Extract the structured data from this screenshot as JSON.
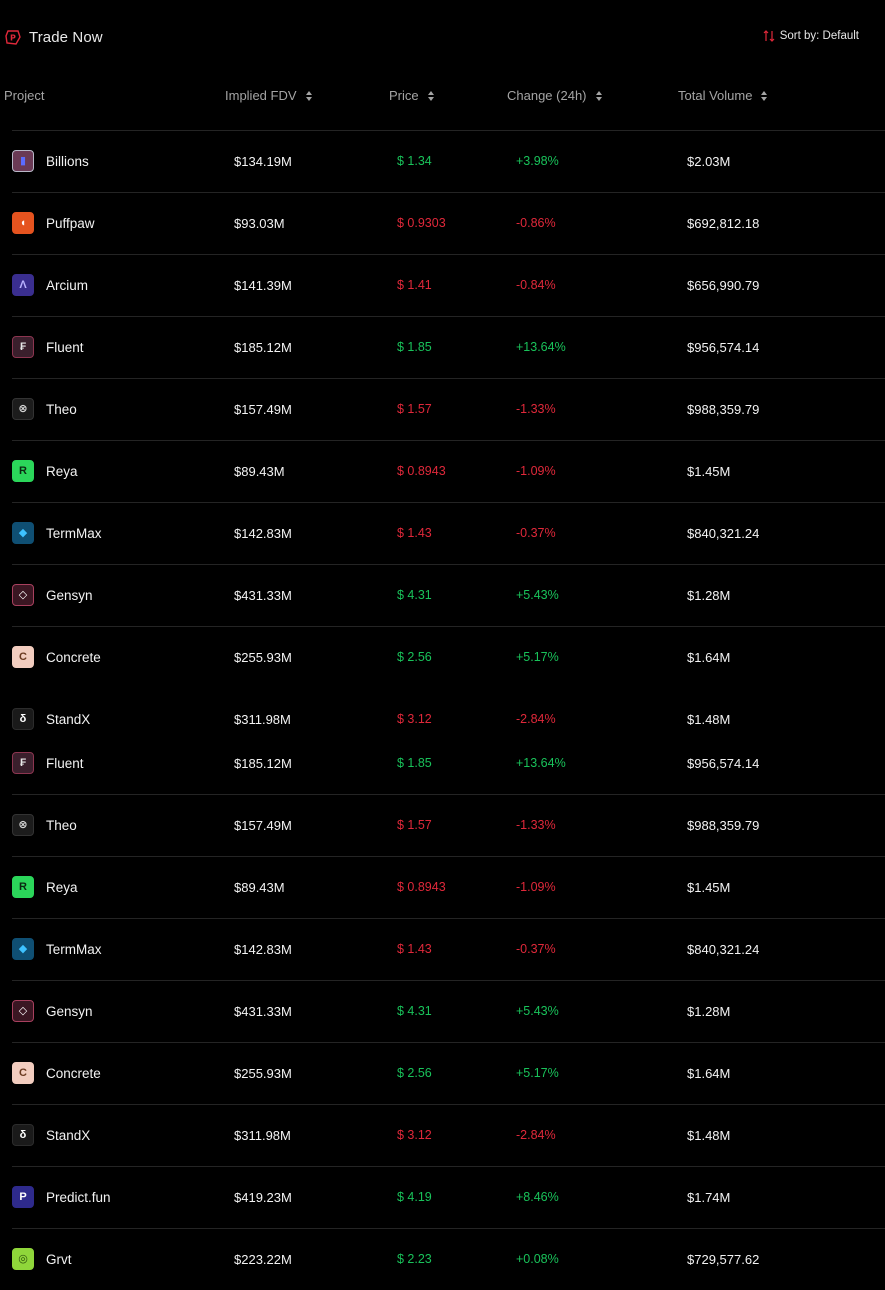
{
  "header": {
    "title": "Trade Now",
    "sort_label": "Sort by: Default"
  },
  "columns": {
    "project": "Project",
    "fdv": "Implied FDV",
    "price": "Price",
    "change": "Change (24h)",
    "volume": "Total Volume"
  },
  "colors": {
    "positive": "#19c25a",
    "negative": "#e0283a",
    "background": "#000000",
    "accent": "#e0283a"
  },
  "rows": [
    {
      "name": "Billions",
      "logo": "billions-logo",
      "logo_glyph": "▮",
      "fdv": "$134.19M",
      "price": "$ 1.34",
      "change": "+3.98%",
      "volume": "$2.03M",
      "trend": "up"
    },
    {
      "name": "Puffpaw",
      "logo": "puffpaw-logo",
      "logo_glyph": "◖",
      "fdv": "$93.03M",
      "price": "$ 0.9303",
      "change": "-0.86%",
      "volume": "$692,812.18",
      "trend": "down"
    },
    {
      "name": "Arcium",
      "logo": "arcium-logo",
      "logo_glyph": "Λ",
      "fdv": "$141.39M",
      "price": "$ 1.41",
      "change": "-0.84%",
      "volume": "$656,990.79",
      "trend": "down"
    },
    {
      "name": "Fluent",
      "logo": "fluent-logo",
      "logo_glyph": "₣",
      "fdv": "$185.12M",
      "price": "$ 1.85",
      "change": "+13.64%",
      "volume": "$956,574.14",
      "trend": "up"
    },
    {
      "name": "Theo",
      "logo": "theo-logo",
      "logo_glyph": "⊗",
      "fdv": "$157.49M",
      "price": "$ 1.57",
      "change": "-1.33%",
      "volume": "$988,359.79",
      "trend": "down"
    },
    {
      "name": "Reya",
      "logo": "reya-logo",
      "logo_glyph": "R",
      "fdv": "$89.43M",
      "price": "$ 0.8943",
      "change": "-1.09%",
      "volume": "$1.45M",
      "trend": "down"
    },
    {
      "name": "TermMax",
      "logo": "termmax-logo",
      "logo_glyph": "◆",
      "fdv": "$142.83M",
      "price": "$ 1.43",
      "change": "-0.37%",
      "volume": "$840,321.24",
      "trend": "down"
    },
    {
      "name": "Gensyn",
      "logo": "gensyn-logo",
      "logo_glyph": "◇",
      "fdv": "$431.33M",
      "price": "$ 4.31",
      "change": "+5.43%",
      "volume": "$1.28M",
      "trend": "up"
    },
    {
      "name": "Concrete",
      "logo": "concrete-logo",
      "logo_glyph": "C",
      "fdv": "$255.93M",
      "price": "$ 2.56",
      "change": "+5.17%",
      "volume": "$1.64M",
      "trend": "up"
    },
    {
      "name": "StandX",
      "logo": "standx-logo",
      "logo_glyph": "δ",
      "fdv": "$311.98M",
      "price": "$ 3.12",
      "change": "-2.84%",
      "volume": "$1.48M",
      "trend": "down"
    },
    {
      "name": "Fluent",
      "logo": "fluent-logo",
      "logo_glyph": "₣",
      "fdv": "$185.12M",
      "price": "$ 1.85",
      "change": "+13.64%",
      "volume": "$956,574.14",
      "trend": "up"
    },
    {
      "name": "Theo",
      "logo": "theo-logo",
      "logo_glyph": "⊗",
      "fdv": "$157.49M",
      "price": "$ 1.57",
      "change": "-1.33%",
      "volume": "$988,359.79",
      "trend": "down"
    },
    {
      "name": "Reya",
      "logo": "reya-logo",
      "logo_glyph": "R",
      "fdv": "$89.43M",
      "price": "$ 0.8943",
      "change": "-1.09%",
      "volume": "$1.45M",
      "trend": "down"
    },
    {
      "name": "TermMax",
      "logo": "termmax-logo",
      "logo_glyph": "◆",
      "fdv": "$142.83M",
      "price": "$ 1.43",
      "change": "-0.37%",
      "volume": "$840,321.24",
      "trend": "down"
    },
    {
      "name": "Gensyn",
      "logo": "gensyn-logo",
      "logo_glyph": "◇",
      "fdv": "$431.33M",
      "price": "$ 4.31",
      "change": "+5.43%",
      "volume": "$1.28M",
      "trend": "up"
    },
    {
      "name": "Concrete",
      "logo": "concrete-logo",
      "logo_glyph": "C",
      "fdv": "$255.93M",
      "price": "$ 2.56",
      "change": "+5.17%",
      "volume": "$1.64M",
      "trend": "up"
    },
    {
      "name": "StandX",
      "logo": "standx-logo",
      "logo_glyph": "δ",
      "fdv": "$311.98M",
      "price": "$ 3.12",
      "change": "-2.84%",
      "volume": "$1.48M",
      "trend": "down"
    },
    {
      "name": "Predict.fun",
      "logo": "predictfun-logo",
      "logo_glyph": "P",
      "fdv": "$419.23M",
      "price": "$ 4.19",
      "change": "+8.46%",
      "volume": "$1.74M",
      "trend": "up"
    },
    {
      "name": "Grvt",
      "logo": "grvt-logo",
      "logo_glyph": "◎",
      "fdv": "$223.22M",
      "price": "$ 2.23",
      "change": "+0.08%",
      "volume": "$729,577.62",
      "trend": "up"
    }
  ]
}
